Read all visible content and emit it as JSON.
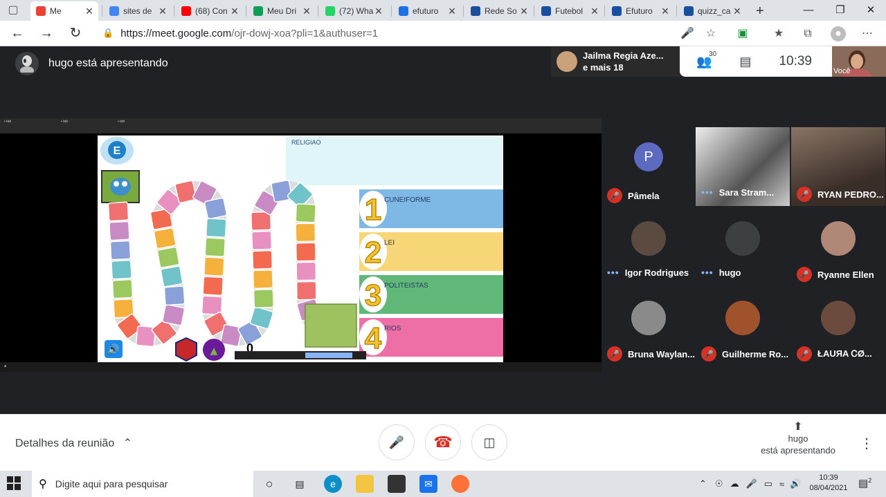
{
  "browser": {
    "tabs": [
      {
        "label": "Me",
        "color": "#ea4335"
      },
      {
        "label": "sites de",
        "color": "#4285f4"
      },
      {
        "label": "(68) Con",
        "color": "#ff0000"
      },
      {
        "label": "Meu Dri",
        "color": "#0f9d58"
      },
      {
        "label": "(72) Wha",
        "color": "#25d366"
      },
      {
        "label": "efuturo",
        "color": "#1a73e8"
      },
      {
        "label": "Rede So",
        "color": "#1a4fa0"
      },
      {
        "label": "Futebol",
        "color": "#1a4fa0"
      },
      {
        "label": "Efuturo",
        "color": "#1a4fa0"
      },
      {
        "label": "quizz_ca",
        "color": "#1a4fa0"
      }
    ],
    "new_tab": "+",
    "window_controls": [
      "—",
      "❐",
      "✕"
    ],
    "url_host": "https://meet.google.com",
    "url_path": "/ojr-dowj-xoa?pli=1&authuser=1"
  },
  "meet": {
    "presenter_text": "hugo está apresentando",
    "top_participant": {
      "line1": "Jailma Regia Aze...",
      "line2": "e mais 18"
    },
    "people_count": "30",
    "clock": "10:39",
    "self_label": "Você",
    "shared_screen": {
      "topic": "RELIGIAO",
      "options": [
        {
          "number": "1",
          "text": "CUNEIFORME",
          "color": "#7eb9e6"
        },
        {
          "number": "2",
          "text": "LEI",
          "color": "#f7d677"
        },
        {
          "number": "3",
          "text": "POLITEISTAS",
          "color": "#5fb877"
        },
        {
          "number": "4",
          "text": "RIOS",
          "color": "#ee6fa6"
        }
      ],
      "logo_letter": "E",
      "score": "0"
    },
    "participants": [
      {
        "name": "Pâmela",
        "initial": "P",
        "muted": true,
        "avatar_color": "#5c6bc0"
      },
      {
        "name": "Sara Stram...",
        "initial": "",
        "muted": false,
        "avatar_color": "#6d6d6d"
      },
      {
        "name": "RYAN PEDRO...",
        "initial": "",
        "muted": true,
        "avatar_color": "#7a6a5c"
      },
      {
        "name": "Igor Rodrigues",
        "initial": "",
        "muted": false,
        "avatar_color": "#5b4a40"
      },
      {
        "name": "hugo",
        "initial": "",
        "muted": false,
        "avatar_color": "#3c4043"
      },
      {
        "name": "Ryanne Ellen",
        "initial": "",
        "muted": true,
        "avatar_color": "#b08878"
      },
      {
        "name": "Bruna Waylan...",
        "initial": "",
        "muted": true,
        "avatar_color": "#8a8a8a"
      },
      {
        "name": "Guilherme Ro...",
        "initial": "",
        "muted": true,
        "avatar_color": "#a0522d"
      },
      {
        "name": "ŁAUЯA ᏟØ...",
        "initial": "",
        "muted": true,
        "avatar_color": "#6b4b3e"
      }
    ],
    "details_label": "Detalhes da reunião",
    "presenting_line1": "hugo",
    "presenting_line2": "está apresentando"
  },
  "taskbar": {
    "search_placeholder": "Digite aqui para pesquisar",
    "time": "10:39",
    "date": "08/04/2021",
    "notification_count": "2"
  }
}
